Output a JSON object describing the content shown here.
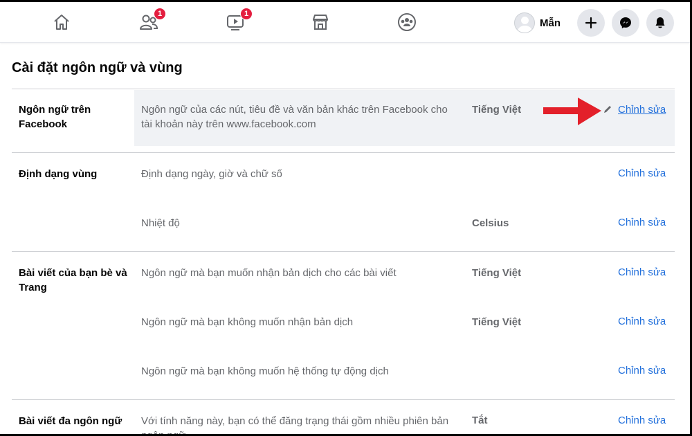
{
  "nav": {
    "badges": {
      "friends": "1",
      "watch": "1"
    },
    "icons": [
      "home-icon",
      "friends-icon",
      "watch-icon",
      "marketplace-icon",
      "groups-icon"
    ],
    "profile_name": "Mẫn",
    "actions": [
      "plus-icon",
      "messenger-icon",
      "notifications-icon"
    ]
  },
  "page": {
    "title": "Cài đặt ngôn ngữ và vùng"
  },
  "sections": {
    "facebook_language": {
      "label": "Ngôn ngữ trên Facebook",
      "desc": "Ngôn ngữ của các nút, tiêu đề và văn bản khác trên Facebook cho tài khoản này trên www.facebook.com",
      "value": "Tiếng Việt",
      "edit": "Chỉnh sửa"
    },
    "region_format": {
      "label": "Định dạng vùng",
      "rows": [
        {
          "desc": "Định dạng ngày, giờ và chữ số",
          "value": "",
          "edit": "Chỉnh sửa"
        },
        {
          "desc": "Nhiệt độ",
          "value": "Celsius",
          "edit": "Chỉnh sửa"
        }
      ]
    },
    "posts_from_friends": {
      "label": "Bài viết của bạn bè và Trang",
      "rows": [
        {
          "desc": "Ngôn ngữ mà bạn muốn nhận bản dịch cho các bài viết",
          "value": "Tiếng Việt",
          "edit": "Chỉnh sửa"
        },
        {
          "desc": "Ngôn ngữ mà bạn không muốn nhận bản dịch",
          "value": "Tiếng Việt",
          "edit": "Chỉnh sửa"
        },
        {
          "desc": "Ngôn ngữ mà bạn không muốn hệ thống tự động dịch",
          "value": "",
          "edit": "Chỉnh sửa"
        }
      ]
    },
    "multilingual_posts": {
      "label": "Bài viết đa ngôn ngữ",
      "desc": "Với tính năng này, bạn có thể đăng trạng thái gồm nhiều phiên bản ngôn ngữ",
      "value": "Tắt",
      "edit": "Chỉnh sửa"
    }
  },
  "colors": {
    "accent": "#216fdb",
    "badge": "#e41e3f",
    "arrow": "#e3202a",
    "highlight_bg": "#f0f2f5"
  }
}
